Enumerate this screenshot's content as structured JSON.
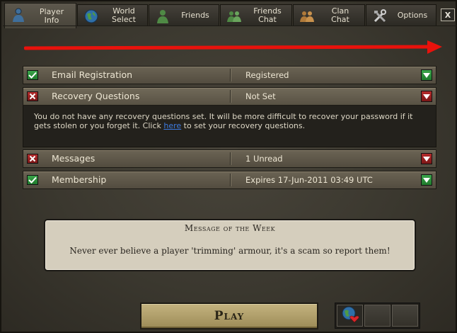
{
  "tabs": [
    {
      "label": "Player\nInfo",
      "icon": "player-icon",
      "active": true
    },
    {
      "label": "World\nSelect",
      "icon": "globe-icon",
      "active": false
    },
    {
      "label": "Friends",
      "icon": "friends-icon",
      "active": false
    },
    {
      "label": "Friends\nChat",
      "icon": "friends-chat-icon",
      "active": false
    },
    {
      "label": "Clan\nChat",
      "icon": "clan-chat-icon",
      "active": false
    },
    {
      "label": "Options",
      "icon": "tools-icon",
      "active": false
    }
  ],
  "close_label": "X",
  "rows": [
    {
      "label": "Email Registration",
      "value": "Registered",
      "status": "ok"
    },
    {
      "label": "Recovery Questions",
      "value": "Not Set",
      "status": "bad"
    },
    {
      "label": "Messages",
      "value": "1 Unread",
      "status": "bad"
    },
    {
      "label": "Membership",
      "value": "Expires 17-Jun-2011 03:49 UTC",
      "status": "ok"
    }
  ],
  "recovery_detail": {
    "text_before": "You do not have any recovery questions set. It will be more difficult to recover your password if it gets stolen or you forget it. Click ",
    "link": "here",
    "text_after": " to set your recovery questions."
  },
  "motw": {
    "title": "Message of the Week",
    "text": "Never ever believe a player 'trimming' armour, it's a scam so report them!"
  },
  "play_label": "Play",
  "colors": {
    "ok": "#2e9a3e",
    "bad": "#a82222",
    "arrow": "#e8120c"
  }
}
